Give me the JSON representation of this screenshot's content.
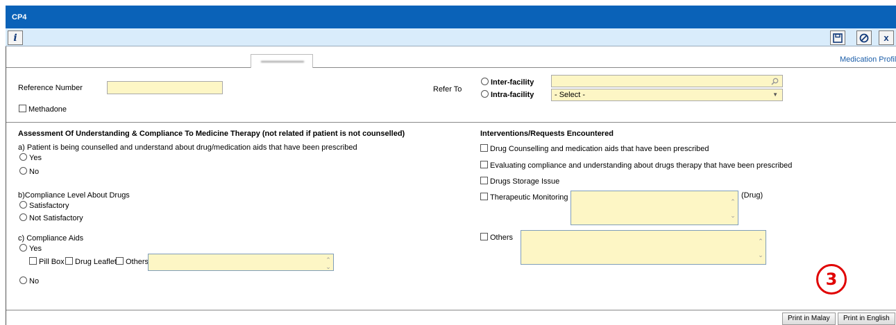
{
  "window": {
    "title": "CP4"
  },
  "toolbar": {
    "info_icon": "info-icon",
    "save_icon": "save-icon",
    "cancel_icon": "cancel-icon",
    "close_label": "x"
  },
  "header": {
    "medication_profile_link": "Medication Profile"
  },
  "reference": {
    "label": "Reference Number",
    "value": "",
    "methadone_label": "Methadone"
  },
  "refer": {
    "label": "Refer To",
    "inter_facility": "Inter-facility",
    "intra_facility": "Intra-facility",
    "intra_select_value": "- Select -"
  },
  "assessment": {
    "title": "Assessment Of Understanding & Compliance To Medicine Therapy (not related if patient is not counselled)",
    "q_a": "a) Patient is being counselled and understand about drug/medication aids that have been prescribed",
    "yes": "Yes",
    "no": "No",
    "q_b": "b)Compliance Level About Drugs",
    "satisfactory": "Satisfactory",
    "not_satisfactory": "Not Satisfactory",
    "q_c": "c) Compliance Aids",
    "pill_box": "Pill Box",
    "drug_leaflet": "Drug Leaflet",
    "others": "Others"
  },
  "interventions": {
    "title": "Interventions/Requests Encountered",
    "drug_counselling": "Drug Counselling and medication aids that have been prescribed",
    "evaluating": "Evaluating compliance and understanding about drugs therapy that have been prescribed",
    "storage": "Drugs Storage Issue",
    "therapeutic": "Therapeutic Monitoring",
    "drug_suffix": "(Drug)",
    "others": "Others"
  },
  "annotation": {
    "step_number": "3",
    "color": "#e00000"
  },
  "footer": {
    "print_malay": "Print in Malay",
    "print_english": "Print in English"
  },
  "colors": {
    "title_bar": "#0a62b8",
    "toolbar": "#d9ecfb",
    "input_fill": "#fdf6c5"
  }
}
